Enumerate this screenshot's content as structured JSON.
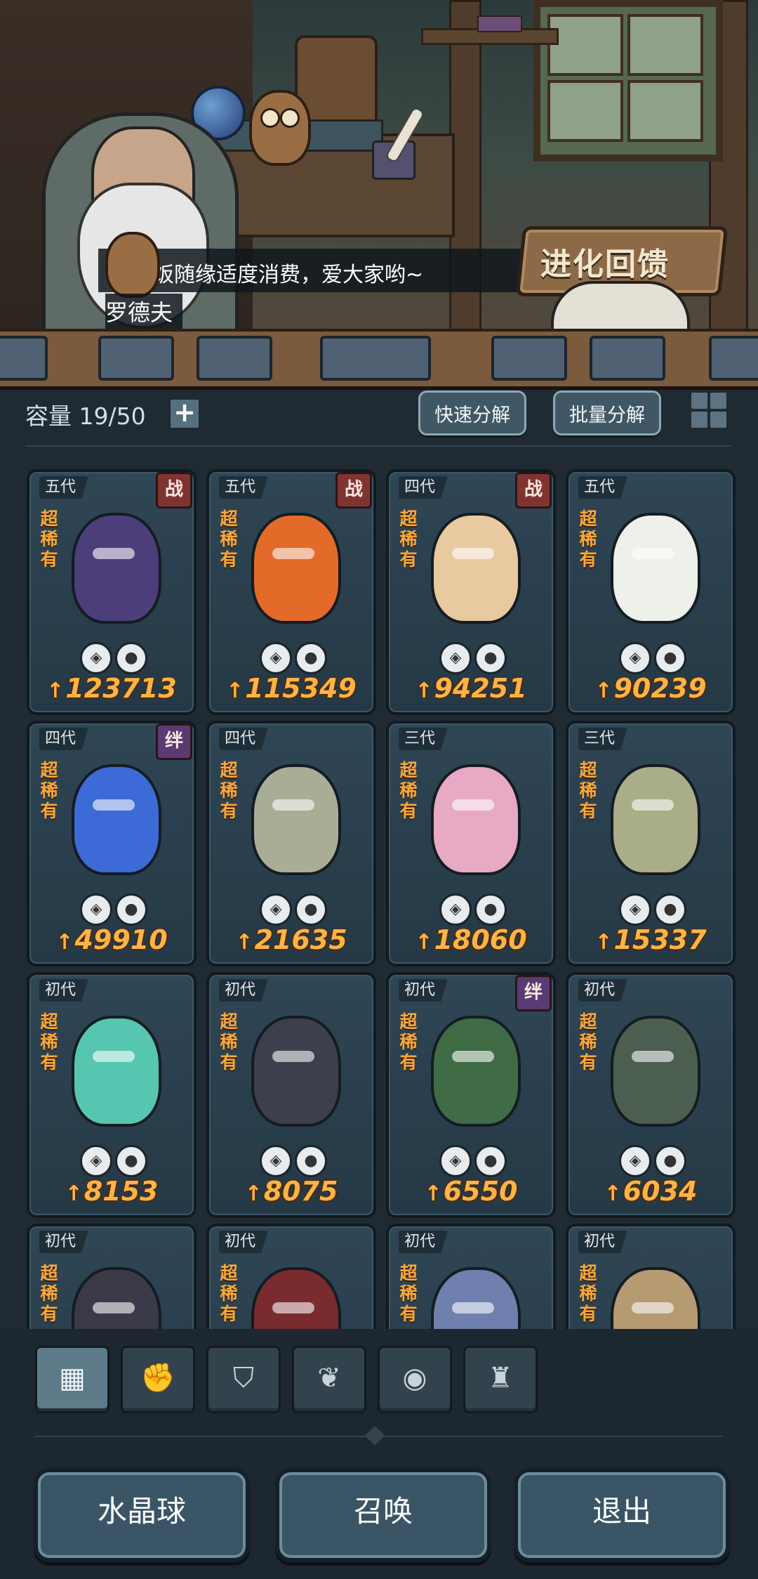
{
  "dialog": {
    "text": "饭随缘适度消费，爱大家哟~",
    "speaker": "罗德夫"
  },
  "banner": {
    "label": "进化回馈"
  },
  "inventory": {
    "capacity_label": "容量 19/50",
    "add_label": "+",
    "quick_decompose": "快速分解",
    "batch_decompose": "批量分解"
  },
  "cards": [
    {
      "generation": "五代",
      "rarity": "超稀有",
      "badge": "战",
      "power": "123713",
      "color": "#4b3e7a"
    },
    {
      "generation": "五代",
      "rarity": "超稀有",
      "badge": "战",
      "power": "115349",
      "color": "#e46a2a"
    },
    {
      "generation": "四代",
      "rarity": "超稀有",
      "badge": "战",
      "power": "94251",
      "color": "#e8c9a0"
    },
    {
      "generation": "五代",
      "rarity": "超稀有",
      "badge": "",
      "power": "90239",
      "color": "#eef0ea"
    },
    {
      "generation": "四代",
      "rarity": "超稀有",
      "badge": "绊",
      "power": "49910",
      "color": "#3c6ad6"
    },
    {
      "generation": "四代",
      "rarity": "超稀有",
      "badge": "",
      "power": "21635",
      "color": "#a9ad96"
    },
    {
      "generation": "三代",
      "rarity": "超稀有",
      "badge": "",
      "power": "18060",
      "color": "#e7a9c4"
    },
    {
      "generation": "三代",
      "rarity": "超稀有",
      "badge": "",
      "power": "15337",
      "color": "#a9ad88"
    },
    {
      "generation": "初代",
      "rarity": "超稀有",
      "badge": "",
      "power": "8153",
      "color": "#56c6b0"
    },
    {
      "generation": "初代",
      "rarity": "超稀有",
      "badge": "",
      "power": "8075",
      "color": "#3d3f4d"
    },
    {
      "generation": "初代",
      "rarity": "超稀有",
      "badge": "绊",
      "power": "6550",
      "color": "#3f6b45"
    },
    {
      "generation": "初代",
      "rarity": "超稀有",
      "badge": "",
      "power": "6034",
      "color": "#4c5e50"
    },
    {
      "generation": "初代",
      "rarity": "超稀有",
      "badge": "",
      "power": "",
      "color": "#3a3a48"
    },
    {
      "generation": "初代",
      "rarity": "超稀有",
      "badge": "",
      "power": "",
      "color": "#7a2b30"
    },
    {
      "generation": "初代",
      "rarity": "超稀有",
      "badge": "",
      "power": "",
      "color": "#6f7fae"
    },
    {
      "generation": "初代",
      "rarity": "超稀有",
      "badge": "",
      "power": "",
      "color": "#b59a72"
    }
  ],
  "filters": [
    {
      "name": "all-icon",
      "glyph": "▦"
    },
    {
      "name": "fist-icon",
      "glyph": "✊"
    },
    {
      "name": "shield-icon",
      "glyph": "⛉"
    },
    {
      "name": "leaf-icon",
      "glyph": "❦"
    },
    {
      "name": "alien-icon",
      "glyph": "◉"
    },
    {
      "name": "tower-icon",
      "glyph": "♜"
    }
  ],
  "buttons": {
    "crystal_ball": "水晶球",
    "summon": "召唤",
    "exit": "退出"
  }
}
